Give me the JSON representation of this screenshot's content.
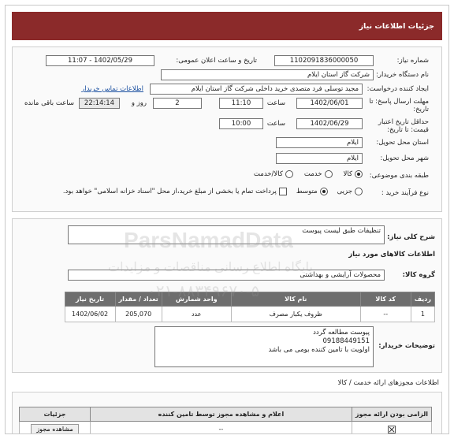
{
  "header": {
    "title": "جزئیات اطلاعات نیاز"
  },
  "fields": {
    "need_number_label": "شماره نیاز:",
    "need_number": "1102091836000050",
    "announce_label": "تاریخ و ساعت اعلان عمومی:",
    "announce_value": "1402/05/29 - 11:07",
    "buyer_org_label": "نام دستگاه خریدار:",
    "buyer_org": "شرکت گاز استان ایلام",
    "creator_label": "ایجاد کننده درخواست:",
    "creator": "مجید توسلی فرد متصدی خرید داخلی شرکت گاز استان ایلام",
    "contact_link": "اطلاعات تماس خریدار",
    "deadline_label": "مهلت ارسال پاسخ: تا تاریخ:",
    "deadline_date": "1402/06/01",
    "deadline_time_label": "ساعت",
    "deadline_time": "11:10",
    "days": "2",
    "days_label": "روز و",
    "remaining_time": "22:14:14",
    "remaining_label": "ساعت باقی مانده",
    "validity_label": "حداقل تاریخ اعتبار قیمت: تا تاریخ:",
    "validity_date": "1402/06/29",
    "validity_time_label": "ساعت",
    "validity_time": "10:00",
    "province_label": "استان محل تحویل:",
    "province": "ایلام",
    "city_label": "شهر محل تحویل:",
    "city": "ایلام",
    "category_label": "طبقه بندی موضوعی:",
    "category_options": [
      "کالا",
      "خدمت",
      "کالا/خدمت"
    ],
    "process_label": "نوع فرآیند خرید :",
    "process_options": [
      "جزیی",
      "متوسط"
    ],
    "payment_note": "پرداخت تمام یا بخشی از مبلغ خرید،از محل \"اسناد خزانه اسلامی\" خواهد بود."
  },
  "need": {
    "summary_label": "شرح کلی نیاز:",
    "summary": "تنظیفات طبق لیست پیوست",
    "goods_info_title": "اطلاعات کالاهای مورد نیاز",
    "group_label": "گروه کالا:",
    "group": "محصولات آرایشی و بهداشتی"
  },
  "table": {
    "headers": [
      "ردیف",
      "کد کالا",
      "نام کالا",
      "واحد شمارش",
      "تعداد / مقدار",
      "تاریخ نیاز"
    ],
    "rows": [
      [
        "1",
        "--",
        "ظروف یکبار مصرف",
        "عدد",
        "205,070",
        "1402/06/02"
      ]
    ]
  },
  "buyer_notes": {
    "label": "توضیحات خریدار:",
    "line1": "پیوست مطالعه گردد",
    "line2": "09188449151",
    "line3": "اولویت با تامین کننده بومی می باشد"
  },
  "service": {
    "title": "اطلاعات مجوزهای ارائه خدمت / کالا",
    "headers": [
      "الزامی بودن ارائه مجوز",
      "اعلام و مشاهده مجوز توسط تامین کننده",
      "جزئیات"
    ],
    "row_value": "--",
    "view_button": "مشاهده مجوز"
  },
  "watermark": {
    "brand": "ParsNamadData",
    "line1": "پایگاه اطلاع رسانی مناقصات و مزایدات",
    "line2": "۰۲۱-۸۸۳۴۹۶۷۰-۵"
  }
}
